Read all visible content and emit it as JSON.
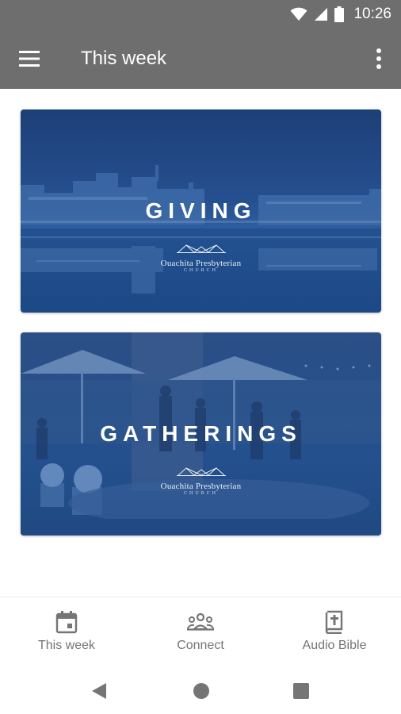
{
  "status_bar": {
    "time": "10:26",
    "icons": [
      "wifi-icon",
      "cell-signal-icon",
      "battery-icon"
    ]
  },
  "app_bar": {
    "title": "This week",
    "menu_icon": "hamburger-menu-icon",
    "overflow_icon": "more-vert-icon",
    "background": "#6e6e6e"
  },
  "cards": [
    {
      "title": "GIVING",
      "logo_name": "Ouachita Presbyterian",
      "logo_sub": "CHURCH",
      "overlay": "#1f4a8c"
    },
    {
      "title": "GATHERINGS",
      "logo_name": "Ouachita Presbyterian",
      "logo_sub": "CHURCH",
      "overlay": "#1f4a8c"
    }
  ],
  "bottom_nav": {
    "items": [
      {
        "label": "This week",
        "icon": "calendar-icon"
      },
      {
        "label": "Connect",
        "icon": "people-icon"
      },
      {
        "label": "Audio Bible",
        "icon": "bible-icon"
      }
    ]
  },
  "system_nav": {
    "buttons": [
      "back-icon",
      "home-icon",
      "recents-icon"
    ]
  }
}
